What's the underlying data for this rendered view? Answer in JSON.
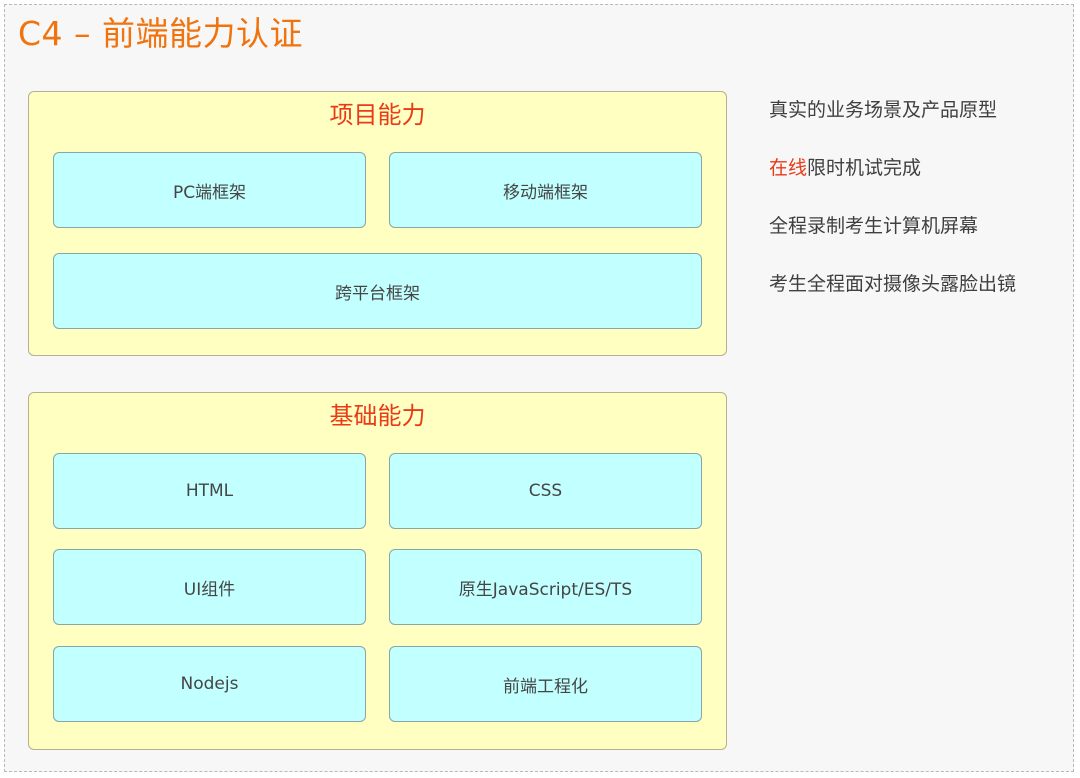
{
  "title": "C4 – 前端能力认证",
  "colors": {
    "title": "#f0730e",
    "group_title": "#ea3a17",
    "group_fill": "#ffffc2",
    "box_fill": "#c2ffff",
    "highlight": "#ea3a17"
  },
  "groups": {
    "project": {
      "title": "项目能力",
      "items": [
        "PC端框架",
        "移动端框架",
        "跨平台框架"
      ]
    },
    "base": {
      "title": "基础能力",
      "items": [
        "HTML",
        "CSS",
        "UI组件",
        "原生JavaScript/ES/TS",
        "Nodejs",
        "前端工程化"
      ]
    }
  },
  "notes": [
    {
      "highlight": "",
      "text": "真实的业务场景及产品原型"
    },
    {
      "highlight": "在线",
      "text": "限时机试完成"
    },
    {
      "highlight": "",
      "text": "全程录制考生计算机屏幕"
    },
    {
      "highlight": "",
      "text": "考生全程面对摄像头露脸出镜"
    }
  ]
}
